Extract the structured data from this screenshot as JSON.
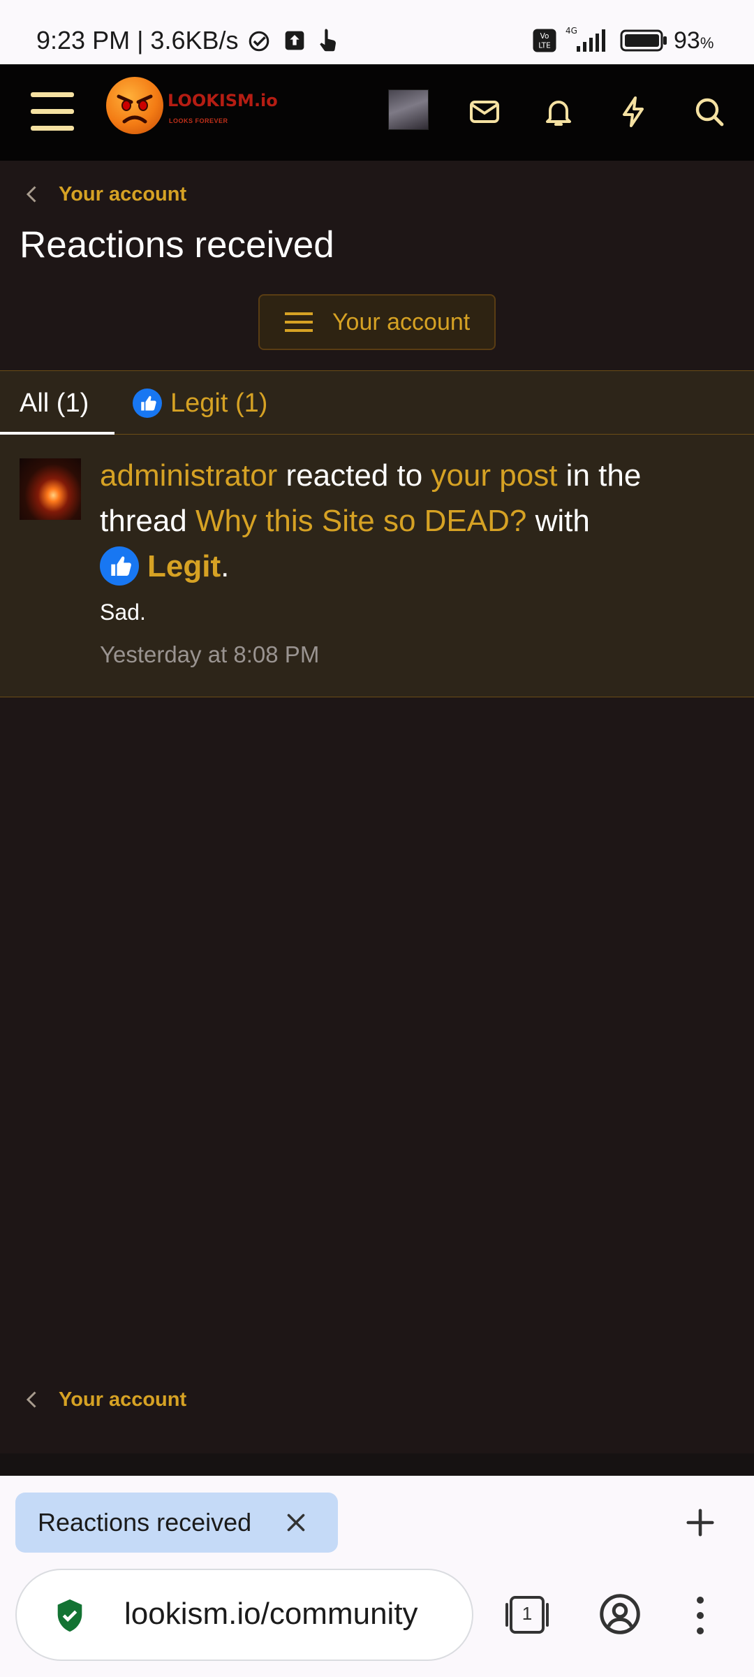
{
  "status_bar": {
    "time": "9:23 PM | 3.6KB/s",
    "battery": "93",
    "battery_unit": "%"
  },
  "header": {
    "logo_text": "LOOKISM.io",
    "logo_tagline": "LOOKS FOREVER"
  },
  "breadcrumb": {
    "label": "Your account"
  },
  "page": {
    "title": "Reactions received",
    "account_menu_label": "Your account"
  },
  "tabs": [
    {
      "label": "All (1)",
      "active": true
    },
    {
      "label": "Legit (1)",
      "active": false
    }
  ],
  "alert": {
    "user": "administrator",
    "text_1": " reacted to ",
    "post_link": "your post",
    "text_2": " in the thread ",
    "thread_title": "Why this Site so DEAD?",
    "text_3": " with",
    "reaction": "Legit",
    "text_4": ".",
    "snippet": "Sad.",
    "time": "Yesterday at 8:08 PM"
  },
  "breadcrumb_bottom": {
    "label": "Your account"
  },
  "browser": {
    "tab_title": "Reactions received",
    "url": "lookism.io/community",
    "tab_count": "1"
  },
  "colors": {
    "accent": "#d6a224",
    "background": "#1e1616",
    "panel": "#2d2519",
    "header": "#050404"
  }
}
